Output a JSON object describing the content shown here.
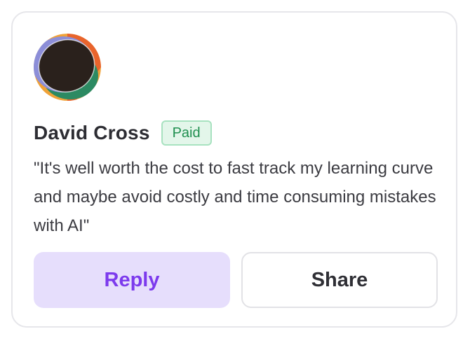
{
  "user": {
    "name": "David Cross",
    "badge": "Paid"
  },
  "testimonial": {
    "quote": "\"It's well worth the cost to fast track my learning curve and maybe avoid costly and time consuming mistakes with AI\""
  },
  "actions": {
    "reply_label": "Reply",
    "share_label": "Share"
  },
  "colors": {
    "accent": "#7c3aed",
    "reply_bg": "#e6defc",
    "badge_text": "#1f8f4f",
    "badge_bg": "#e3f6ea"
  }
}
